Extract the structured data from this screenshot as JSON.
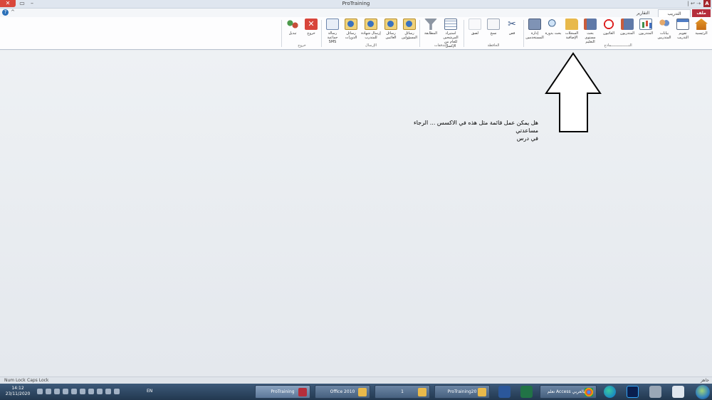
{
  "window": {
    "title": "ProTraining",
    "close_glyph": "✕",
    "maximize_glyph": "▭",
    "minimize_glyph": "–",
    "app_logo": "A",
    "qat_text": "| ↩ ⇢"
  },
  "tabs": {
    "file": "ملف",
    "training_admin": "التدريب الإداري",
    "reports": "التقارير",
    "help": "?",
    "ribbon_toggle": "^"
  },
  "ribbon": {
    "groups": {
      "forms": "النـــــــــــــــــماذج",
      "clipboard": "الحافظة",
      "filters": "التدفقات",
      "sending": "الإرسال",
      "exit": "خروج"
    },
    "buttons": {
      "home": "الرئيسية",
      "training_calendar": "تقويم التدريب",
      "trainee_data": "بيانات المتدربين",
      "trainers": "المتدربون",
      "trainees_report": "المتدربون",
      "absentees": "الغائبون",
      "edu_level_search": "بحث مستوى التعليم",
      "certificates": "السجلات الإضافية",
      "search_course": "بحث بدورة",
      "management": "إدارة المستخدمين",
      "cut": "قص",
      "copy": "نسخ",
      "paste": "لصق",
      "import_trainees": "استيراد المرشحين للعام من الإكسل",
      "filter": "المطابقة",
      "msg_officials": "رسائل المسؤولين",
      "msg_absent": "رسائل الغائبين",
      "send_certificate": "إرسال شهادة للمتدرب",
      "msg_course": "رسائل الدورات",
      "sms_group": "رسالة جماعية SMS",
      "exit": "خروج",
      "switch": "تبديل"
    }
  },
  "main": {
    "note_line1": "هل يمكن عمل قائمة مثل هذه في الاكسس ... الرجاء مساعدتي",
    "note_line2": "في درس"
  },
  "statusbar": {
    "mode": "جاهز",
    "num_lock": "Num Lock",
    "caps_lock": "Caps Lock"
  },
  "taskbar": {
    "time": "14:12",
    "date": "23/11/2020",
    "language": "EN",
    "tasks": [
      "ProTraining",
      "Office 2010",
      "1",
      "ProTraining20",
      "تعلم Access بالعربي..."
    ]
  },
  "colors": {
    "file_tab": "#b52e3b",
    "accent": "#2a6fb8",
    "taskbar": "#22384f"
  }
}
